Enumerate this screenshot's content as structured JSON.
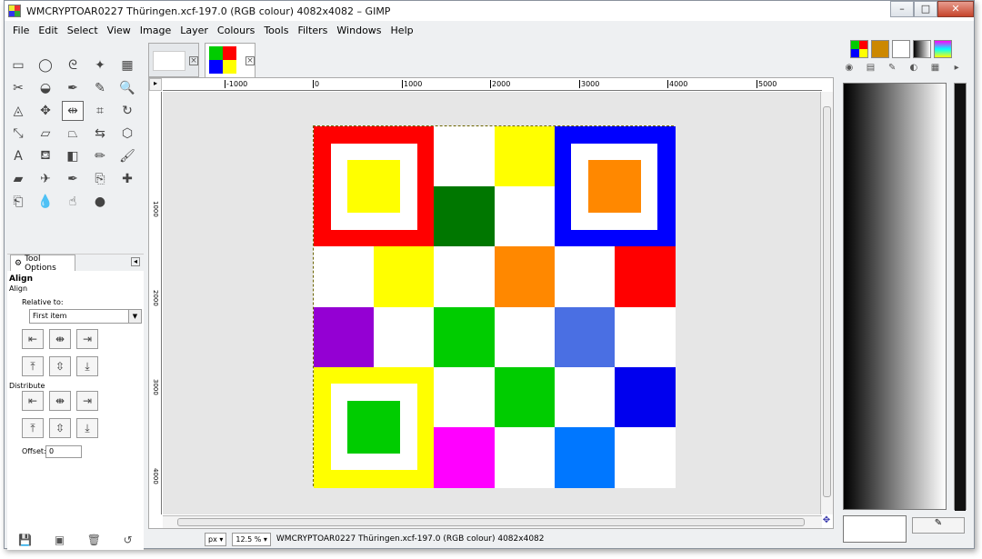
{
  "window": {
    "title": "WMCRYPTOAR0227 Thüringen.xcf-197.0 (RGB colour) 4082x4082 – GIMP",
    "minimize": "–",
    "maximize": "□",
    "close": "✕"
  },
  "menu": [
    "File",
    "Edit",
    "Select",
    "View",
    "Image",
    "Layer",
    "Colours",
    "Tools",
    "Filters",
    "Windows",
    "Help"
  ],
  "toolbox": {
    "tools": [
      {
        "name": "rect-select-icon",
        "glyph": "▭"
      },
      {
        "name": "ellipse-select-icon",
        "glyph": "◯"
      },
      {
        "name": "free-select-icon",
        "glyph": "ᘓ"
      },
      {
        "name": "fuzzy-select-icon",
        "glyph": "✦"
      },
      {
        "name": "color-select-icon",
        "glyph": "▦"
      },
      {
        "name": "scissors-icon",
        "glyph": "✂"
      },
      {
        "name": "foreground-select-icon",
        "glyph": "◒"
      },
      {
        "name": "paths-icon",
        "glyph": "✒"
      },
      {
        "name": "color-picker-icon",
        "glyph": "✎"
      },
      {
        "name": "zoom-icon",
        "glyph": "🔍"
      },
      {
        "name": "measure-icon",
        "glyph": "◬"
      },
      {
        "name": "move-icon",
        "glyph": "✥"
      },
      {
        "name": "align-icon",
        "glyph": "⇹"
      },
      {
        "name": "crop-icon",
        "glyph": "⌗"
      },
      {
        "name": "rotate-icon",
        "glyph": "↻"
      },
      {
        "name": "scale-icon",
        "glyph": "⤡"
      },
      {
        "name": "shear-icon",
        "glyph": "▱"
      },
      {
        "name": "perspective-icon",
        "glyph": "⏢"
      },
      {
        "name": "flip-icon",
        "glyph": "⇆"
      },
      {
        "name": "cage-icon",
        "glyph": "⬡"
      },
      {
        "name": "text-icon",
        "glyph": "A"
      },
      {
        "name": "bucket-fill-icon",
        "glyph": "⛾"
      },
      {
        "name": "blend-icon",
        "glyph": "◧"
      },
      {
        "name": "pencil-icon",
        "glyph": "✏"
      },
      {
        "name": "paintbrush-icon",
        "glyph": "🖌"
      },
      {
        "name": "eraser-icon",
        "glyph": "▰"
      },
      {
        "name": "airbrush-icon",
        "glyph": "✈"
      },
      {
        "name": "ink-icon",
        "glyph": "✒"
      },
      {
        "name": "clone-icon",
        "glyph": "⎘"
      },
      {
        "name": "heal-icon",
        "glyph": "✚"
      },
      {
        "name": "perspective-clone-icon",
        "glyph": "⎗"
      },
      {
        "name": "blur-icon",
        "glyph": "💧"
      },
      {
        "name": "smudge-icon",
        "glyph": "☝"
      },
      {
        "name": "dodge-burn-icon",
        "glyph": "●"
      }
    ],
    "selected_tool_index": 12,
    "fg_color": "#ffffff",
    "bg_color": "#ffffff"
  },
  "tool_options": {
    "tab_label": "Tool Options",
    "heading": "Align",
    "subheading": "Align",
    "relative_label": "Relative to:",
    "relative_value": "First item",
    "distribute_label": "Distribute",
    "offset_label": "Offset:",
    "offset_value": "0"
  },
  "rulers": {
    "h_ticks": [
      "-1000",
      "0",
      "1000",
      "2000",
      "3000",
      "4000",
      "5000"
    ],
    "v_ticks": [
      "1000",
      "2000",
      "3000",
      "4000"
    ]
  },
  "image_grid": {
    "size": 6,
    "cells": [
      [
        "#ff0000",
        "#ff0000",
        "#ffffff",
        "#ffff00",
        "#0000ff",
        "#0000ff"
      ],
      [
        "#ff0000",
        "#ff0000",
        "#007700",
        "#ffffff",
        "#0000ff",
        "#0000ff"
      ],
      [
        "#ffffff",
        "#ffff00",
        "#ffffff",
        "#ff8800",
        "#ffffff",
        "#ff0000"
      ],
      [
        "#9400d3",
        "#ffffff",
        "#00cc00",
        "#ffffff",
        "#4a6fe3",
        "#ffffff"
      ],
      [
        "#ffff00",
        "#ffff00",
        "#ffffff",
        "#00cc00",
        "#ffffff",
        "#0000ee"
      ],
      [
        "#ffff00",
        "#ffff00",
        "#ff00ff",
        "#ffffff",
        "#0077ff",
        "#ffffff"
      ]
    ],
    "framed_squares": [
      {
        "row": 0,
        "col": 0,
        "frame": "#ff0000",
        "inner": "#ffff00"
      },
      {
        "row": 0,
        "col": 4,
        "frame": "#0000ff",
        "inner": "#ff8800"
      },
      {
        "row": 4,
        "col": 0,
        "frame": "#ffff00",
        "inner": "#00cc00"
      }
    ]
  },
  "status": {
    "unit": "px",
    "zoom": "12.5 %",
    "info": "WMCRYPTOAR0227 Thüringen.xcf-197.0 (RGB colour) 4082x4082"
  },
  "right_panel": {
    "gradient_from": "#000000",
    "gradient_to": "#ffffff"
  }
}
